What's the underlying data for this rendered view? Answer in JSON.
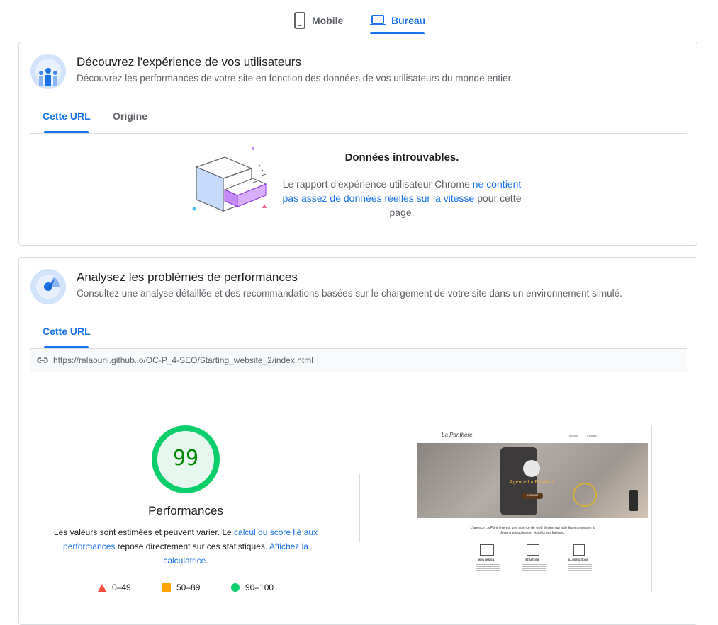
{
  "device_tabs": {
    "mobile": "Mobile",
    "desktop": "Bureau"
  },
  "field": {
    "title": "Découvrez l'expérience de vos utilisateurs",
    "subtitle": "Découvrez les performances de votre site en fonction des données de vos utilisateurs du monde entier.",
    "tabs": [
      "Cette URL",
      "Origine"
    ],
    "no_data_title": "Données introuvables.",
    "no_data_text_1": "Le rapport d'expérience utilisateur Chrome ",
    "no_data_link": "ne contient pas assez de données réelles sur la vitesse",
    "no_data_text_2": " pour cette page."
  },
  "lab": {
    "title": "Analysez les problèmes de performances",
    "subtitle": "Consultez une analyse détaillée et des recommandations basées sur le chargement de votre site dans un environnement simulé.",
    "tab": "Cette URL",
    "url": "https://ralaouni.github.io/OC-P_4-SEO/Starting_website_2/index.html",
    "score": "99",
    "score_value": 99,
    "score_label": "Performances",
    "desc_1": "Les valeurs sont estimées et peuvent varier. Le ",
    "desc_link_1": "calcul du score lié aux performances",
    "desc_2": " repose directement sur ces statistiques. ",
    "desc_link_2": "Affichez la calculatrice",
    "desc_3": ".",
    "legend": [
      {
        "range": "0–49",
        "color": "#ff4e42"
      },
      {
        "range": "50–89",
        "color": "#ffa400"
      },
      {
        "range": "90–100",
        "color": "#0cce6b"
      }
    ],
    "screenshot": {
      "logo": "La Panthère",
      "nav": [
        "Accueil",
        "Contact"
      ],
      "hero": "Agence La Panthère",
      "cta": "CONTACT",
      "intro": "L'agence La Panthère est une agence de web design qui aide les entreprises à devenir attractives et visibles sur Internet.",
      "services": [
        "WEB DESIGN",
        "STRATÉGIE",
        "ILLUSTRATIONS"
      ]
    }
  }
}
